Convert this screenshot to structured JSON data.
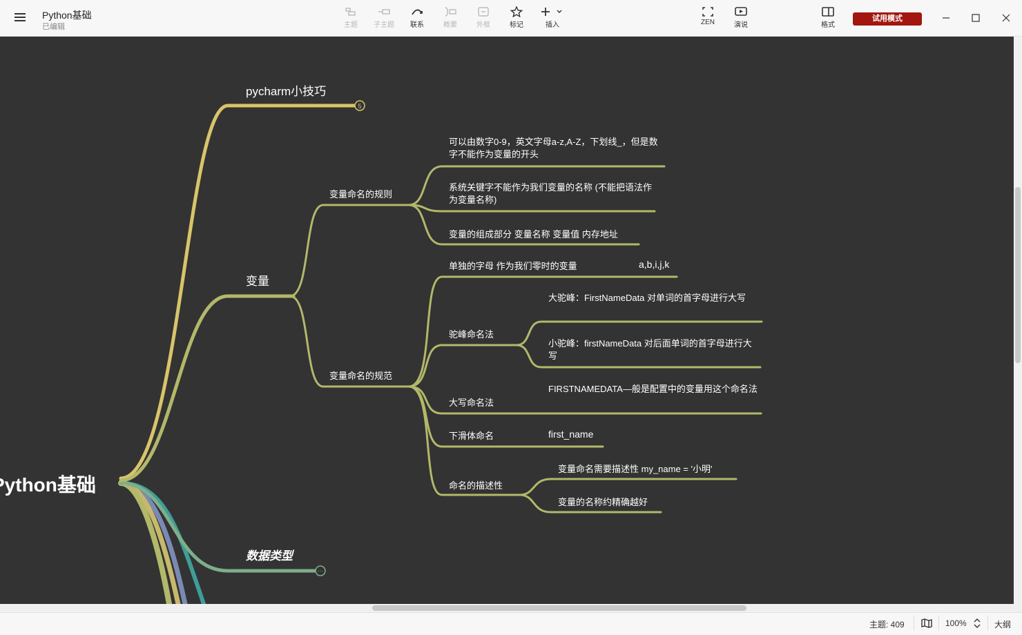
{
  "window": {
    "doc_title": "Python基础",
    "doc_status": "已编辑",
    "trial_label": "试用模式"
  },
  "toolbar": [
    {
      "label": "主题",
      "icon": "topic-icon",
      "enabled": false
    },
    {
      "label": "子主题",
      "icon": "subtopic-icon",
      "enabled": false
    },
    {
      "label": "联系",
      "icon": "relationship-icon",
      "enabled": true
    },
    {
      "label": "概要",
      "icon": "summary-icon",
      "enabled": false
    },
    {
      "label": "外框",
      "icon": "boundary-icon",
      "enabled": false
    },
    {
      "label": "标记",
      "icon": "star-icon",
      "enabled": true
    },
    {
      "label": "插入",
      "icon": "plus-icon",
      "enabled": true
    },
    {
      "label": "ZEN",
      "icon": "fullscreen-icon",
      "enabled": true
    },
    {
      "label": "演说",
      "icon": "pitch-icon",
      "enabled": true
    },
    {
      "label": "格式",
      "icon": "format-panel-icon",
      "enabled": true
    }
  ],
  "mindmap": {
    "root": "Python基础",
    "pycharm": {
      "label": "pycharm小技巧",
      "collapsed_count": "5"
    },
    "variable": {
      "label": "变量",
      "rules": {
        "label": "变量命名的规则",
        "items": [
          "可以由数字0-9，英文字母a-z,A-Z，下划线_，但是数字不能作为变量的开头",
          "系统关键字不能作为我们变量的名称 (不能把语法作为变量名称)",
          "变量的组成部分 变量名称 变量值 内存地址"
        ]
      },
      "norms": {
        "label": "变量命名的规范",
        "single_letter": {
          "label": "单独的字母 作为我们零时的变量",
          "example": "a,b,i,j,k"
        },
        "camel": {
          "label": "驼峰命名法",
          "upper": "大驼峰：FirstNameData 对单词的首字母进行大写",
          "lower": "小驼峰：firstNameData 对后面单词的首字母进行大写"
        },
        "uppercase": {
          "label": "大写命名法",
          "detail": "FIRSTNAMEDATA—般是配置中的变量用这个命名法"
        },
        "snake": {
          "label": "下滑体命名",
          "detail": "first_name"
        },
        "descriptive": {
          "label": "命名的描述性",
          "items": [
            "变量命名需要描述性 my_name = '小明'",
            "变量的名称约精确越好"
          ]
        }
      }
    },
    "datatypes": {
      "label": "数据类型",
      "collapsed_marker": "···"
    }
  },
  "colors": {
    "canvas": "#333333",
    "branch_pycharm": "#d8c46a",
    "branch_variable": "#b3b86a",
    "branch_datatypes": "#7fae8a",
    "accent_trial": "#a3160f"
  },
  "status": {
    "topic_count": "主题: 409",
    "zoom": "100%",
    "outline_label": "大纲"
  }
}
